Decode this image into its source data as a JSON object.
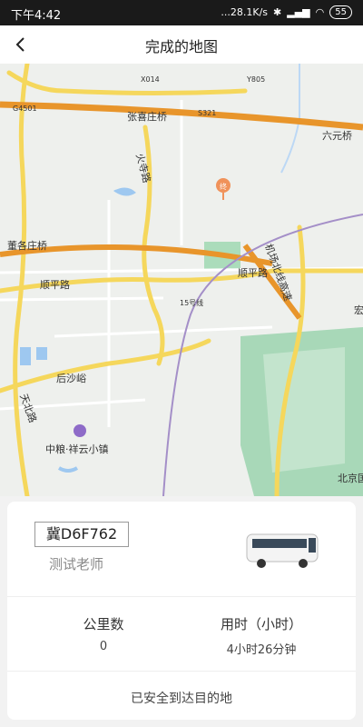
{
  "status_bar": {
    "time": "下午4:42",
    "network": "...28.1K/s",
    "battery": "55"
  },
  "header": {
    "title": "完成的地图"
  },
  "map": {
    "roads": [
      "张喜庄桥",
      "S321",
      "六元桥",
      "火寺路",
      "董各庄桥",
      "顺平路",
      "顺平路",
      "机场北线高速",
      "15号线",
      "后沙峪",
      "天北路",
      "X014",
      "Y805",
      "G4501",
      "中粮·祥云小镇",
      "北京国际",
      "宏"
    ],
    "marker_label": "终"
  },
  "trip": {
    "plate": "冀D6F762",
    "driver": "测试老师",
    "distance_label": "公里数",
    "distance_value": "0",
    "duration_label": "用时（小时）",
    "duration_value": "4小时26分钟",
    "status": "已安全到达目的地"
  },
  "colors": {
    "highway": "#e8952b",
    "road": "#f5d75c",
    "airport": "#a8d8b8"
  }
}
